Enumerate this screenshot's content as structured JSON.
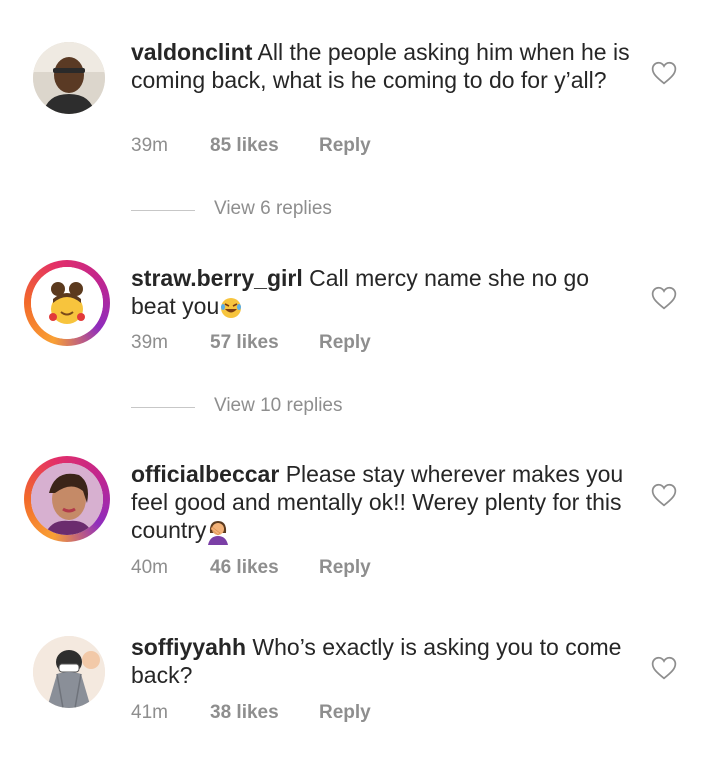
{
  "comments": [
    {
      "username": "valdonclint",
      "text": "All the people asking him when he is coming back, what is he coming to do for y’all?",
      "time": "39m",
      "likes": "85 likes",
      "reply": "Reply",
      "view_replies": "View 6 replies",
      "story_ring": false
    },
    {
      "username": "straw.berry_girl",
      "text": "Call mercy name she no go beat you",
      "emoji": "face-with-tears-of-joy",
      "time": "39m",
      "likes": "57 likes",
      "reply": "Reply",
      "view_replies": "View 10 replies",
      "story_ring": true
    },
    {
      "username": "officialbeccar",
      "text": "Please stay wherever makes you feel good and mentally ok!! Werey plenty for this country",
      "emoji": "woman-facepalming",
      "time": "40m",
      "likes": "46 likes",
      "reply": "Reply",
      "story_ring": true
    },
    {
      "username": "soffiyyahh",
      "text": "Who’s exactly is asking you to come back?",
      "time": "41m",
      "likes": "38 likes",
      "reply": "Reply",
      "story_ring": false
    }
  ],
  "icons": {
    "like": "heart-outline-icon"
  },
  "colors": {
    "text": "#262626",
    "secondary": "#8e8e8e",
    "divider": "#c7c7c7"
  }
}
